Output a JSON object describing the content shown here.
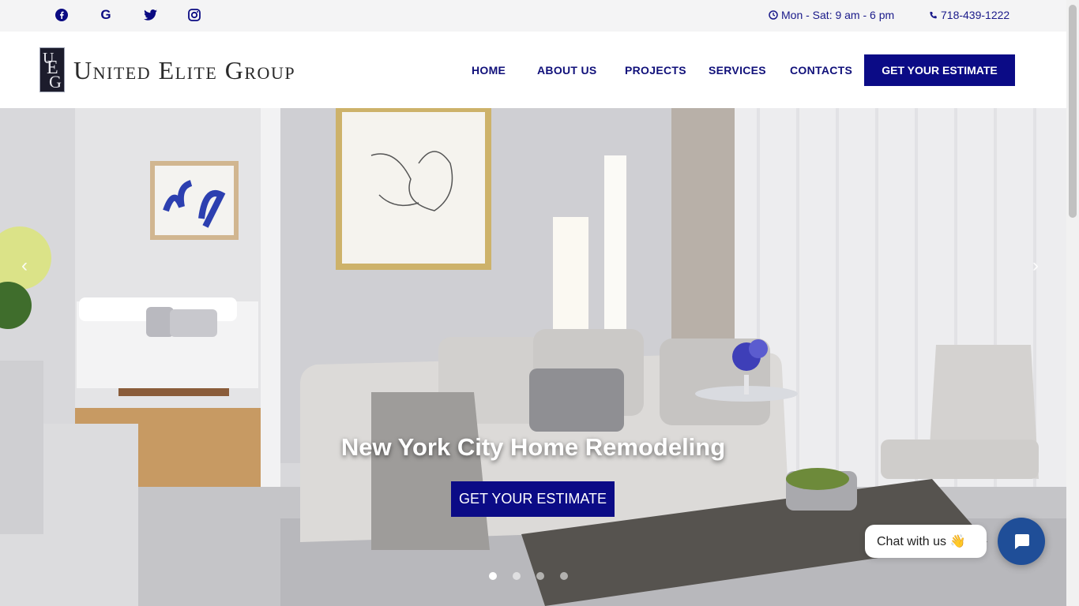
{
  "topbar": {
    "social": [
      {
        "name": "facebook-icon"
      },
      {
        "name": "google-icon"
      },
      {
        "name": "twitter-icon"
      },
      {
        "name": "instagram-icon"
      }
    ],
    "hours": "Mon - Sat: 9 am - 6 pm",
    "phone": "718-439-1222"
  },
  "header": {
    "logo_text": "United Elite Group",
    "logo_letters": [
      "U",
      "E",
      "G"
    ],
    "nav": [
      "HOME",
      "ABOUT US",
      "PROJECTS",
      "SERVICES",
      "CONTACTS"
    ],
    "cta": "GET YOUR ESTIMATE"
  },
  "hero": {
    "title": "New York City Home Remodeling",
    "button": "GET YOUR ESTIMATE",
    "prev": "‹",
    "next": "›",
    "slide_count": 4,
    "active_slide": 1
  },
  "chat": {
    "label": "Chat with us 👋"
  },
  "colors": {
    "brand_navy": "#0b0b86",
    "link_navy": "#10107a",
    "chat_blue": "#1f4e98"
  }
}
